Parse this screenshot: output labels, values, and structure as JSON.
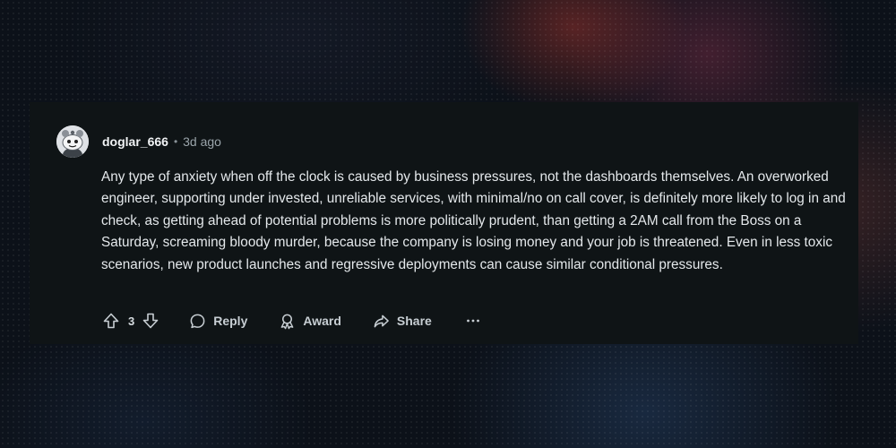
{
  "comment": {
    "author": "doglar_666",
    "separator": "•",
    "timestamp": "3d ago",
    "body": "Any type of anxiety when off the clock is caused by business pressures, not the dashboards themselves. An overworked engineer, supporting under invested, unreliable services, with minimal/no on call cover, is definitely more likely to log in and check, as getting ahead of potential problems is more politically prudent, than getting a 2AM call from the Boss on a Saturday, screaming bloody murder, because the company is losing money and your job is threatened. Even in less toxic scenarios, new product launches and regressive deployments can cause similar conditional pressures.",
    "avatar_icon": "snoo-avatar"
  },
  "actions": {
    "vote_count": "3",
    "reply_label": "Reply",
    "award_label": "Award",
    "share_label": "Share",
    "upvote_icon": "arrow-up-icon",
    "downvote_icon": "arrow-down-icon",
    "reply_icon": "speech-bubble-icon",
    "award_icon": "award-ribbon-icon",
    "share_icon": "share-arrow-icon",
    "more_icon": "ellipsis-icon"
  },
  "colors": {
    "card_background": "#0f1416",
    "page_background": "#0c1119",
    "text_primary": "#e4e8eb",
    "text_secondary": "#9aa4aa"
  }
}
